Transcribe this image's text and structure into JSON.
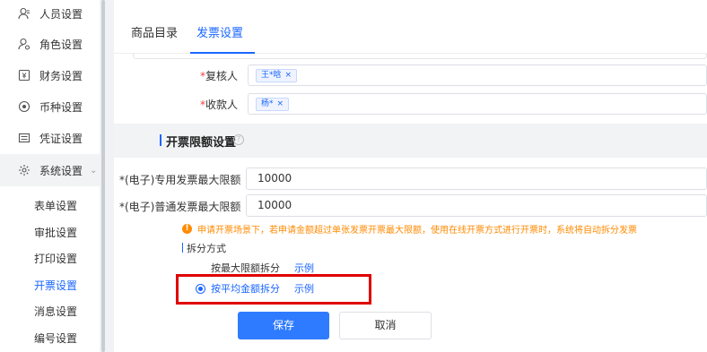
{
  "sidebar": {
    "items": [
      {
        "label": "人员设置",
        "icon": "person-icon"
      },
      {
        "label": "角色设置",
        "icon": "role-icon"
      },
      {
        "label": "财务设置",
        "icon": "finance-icon"
      },
      {
        "label": "币种设置",
        "icon": "currency-icon"
      },
      {
        "label": "凭证设置",
        "icon": "voucher-icon"
      },
      {
        "label": "系统设置",
        "icon": "system-settings-icon"
      }
    ],
    "sub_items": [
      {
        "label": "表单设置"
      },
      {
        "label": "审批设置"
      },
      {
        "label": "打印设置"
      },
      {
        "label": "开票设置"
      },
      {
        "label": "消息设置"
      },
      {
        "label": "编号设置"
      }
    ],
    "active_sub": "开票设置"
  },
  "tabs": [
    {
      "label": "商品目录"
    },
    {
      "label": "发票设置"
    }
  ],
  "form": {
    "reviewer_label": "复核人",
    "reviewer_tag": "王*晗",
    "payee_label": "收款人",
    "payee_tag": "杨*",
    "required_mark": "*",
    "tag_close": "×"
  },
  "limit_section": {
    "title": "开票限额设置",
    "special_label": "*(电子)专用发票最大限额",
    "special_value": "10000",
    "normal_label": "*(电子)普通发票最大限额",
    "normal_value": "10000",
    "warning": "申请开票场景下，若申请金额超过单张发票开票最大限额，使用在线开票方式进行开票时，系统将自动拆分发票",
    "split_title": "拆分方式",
    "option_max": "按最大限额拆分",
    "option_avg": "按平均金额拆分",
    "example": "示例",
    "selected_option": "按平均金额拆分"
  },
  "buttons": {
    "save": "保存",
    "cancel": "取消"
  },
  "colors": {
    "primary": "#1a66ff",
    "warning": "#ff8a00",
    "required": "#f53f3f",
    "highlight": "#e00000"
  }
}
